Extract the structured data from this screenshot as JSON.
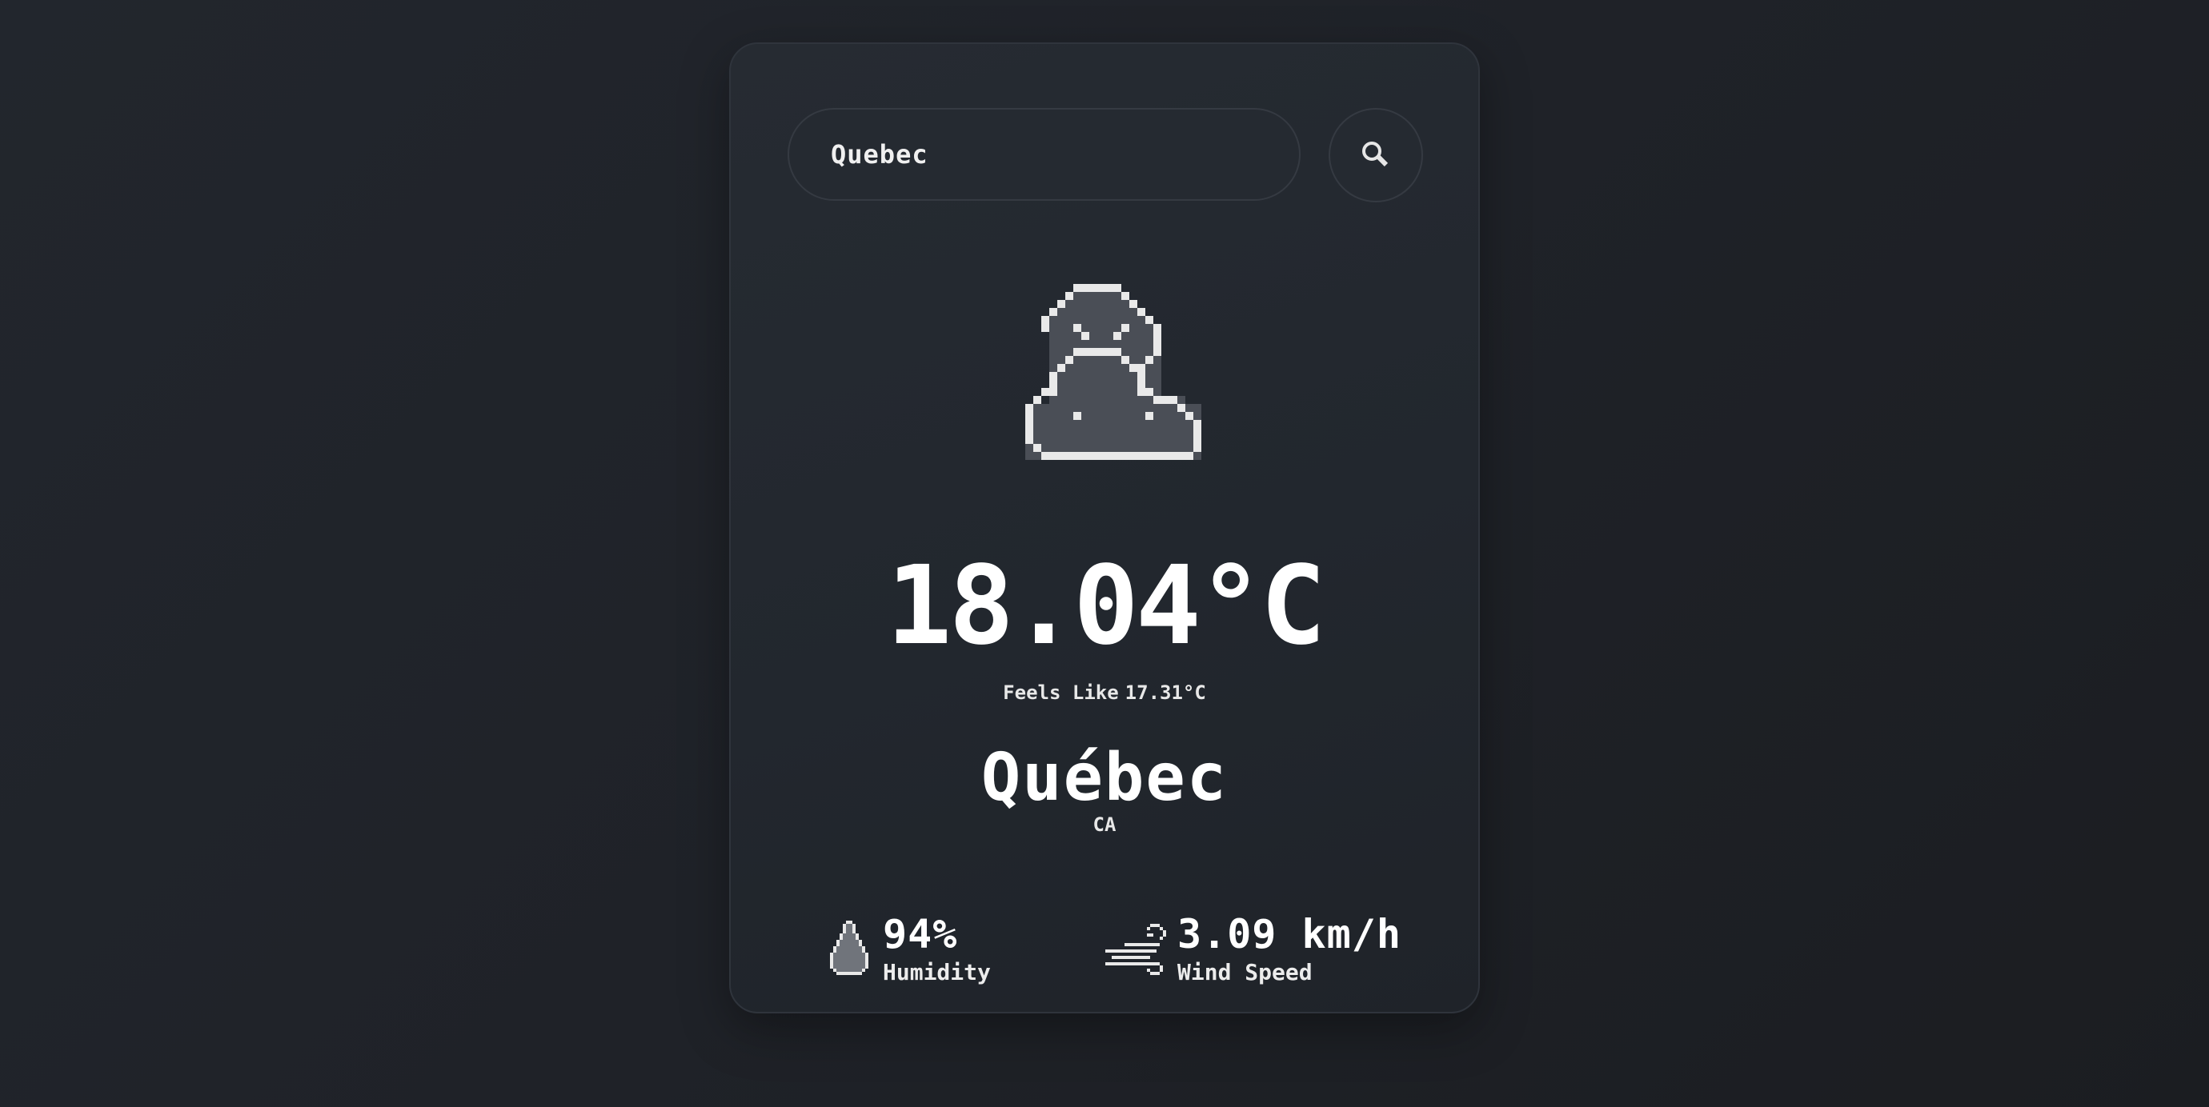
{
  "search": {
    "value": "Quebec",
    "button_icon": "search-icon"
  },
  "weather": {
    "icon": "cloudy-icon",
    "temperature": "18.04°C",
    "feels_like_label": "Feels Like",
    "feels_like_value": "17.31°C",
    "city": "Québec",
    "country": "CA"
  },
  "stats": {
    "humidity": {
      "value": "94%",
      "label": "Humidity",
      "icon": "water-drop-icon"
    },
    "wind": {
      "value": "3.09 km/h",
      "label": "Wind Speed",
      "icon": "wind-icon"
    }
  },
  "colors": {
    "background": "#1f2228",
    "card": "#23272e",
    "text": "#ffffff",
    "cloud_fill": "#4a4e56",
    "outline": "#e9e9e9"
  }
}
